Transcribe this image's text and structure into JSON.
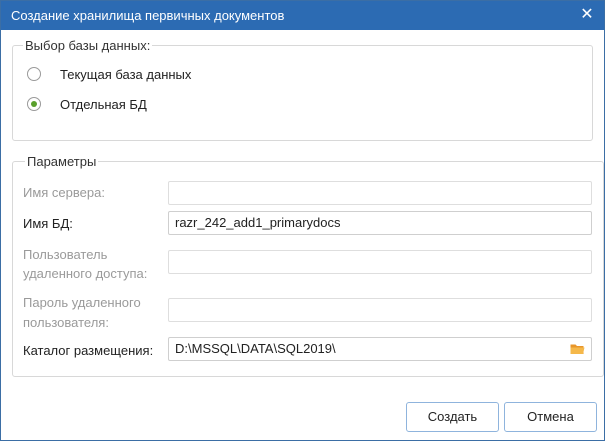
{
  "window": {
    "title": "Создание хранилища первичных документов",
    "close_icon": "close-icon",
    "accent_color": "#2c6bb3"
  },
  "db_choice": {
    "legend": "Выбор базы данных:",
    "options": [
      {
        "label": "Текущая база данных",
        "checked": false
      },
      {
        "label": "Отдельная БД",
        "checked": true
      }
    ],
    "radio_checked_color": "#5aa02c"
  },
  "params": {
    "legend": "Параметры",
    "server_name": {
      "label": "Имя сервера:",
      "value": "",
      "enabled": false
    },
    "db_name": {
      "label": "Имя БД:",
      "value": "razr_242_add1_primarydocs",
      "enabled": true
    },
    "remote_user": {
      "label_line1": "Пользователь",
      "label_line2": "удаленного доступа:",
      "value": "",
      "enabled": false
    },
    "remote_password": {
      "label_line1": "Пароль удаленного",
      "label_line2": "пользователя:",
      "value": "",
      "enabled": false
    },
    "location": {
      "label": "Каталог размещения:",
      "value": "D:\\MSSQL\\DATA\\SQL2019\\",
      "enabled": true,
      "icon": "folder-icon",
      "icon_color": "#f0a830"
    }
  },
  "buttons": {
    "create": "Создать",
    "cancel": "Отмена"
  }
}
